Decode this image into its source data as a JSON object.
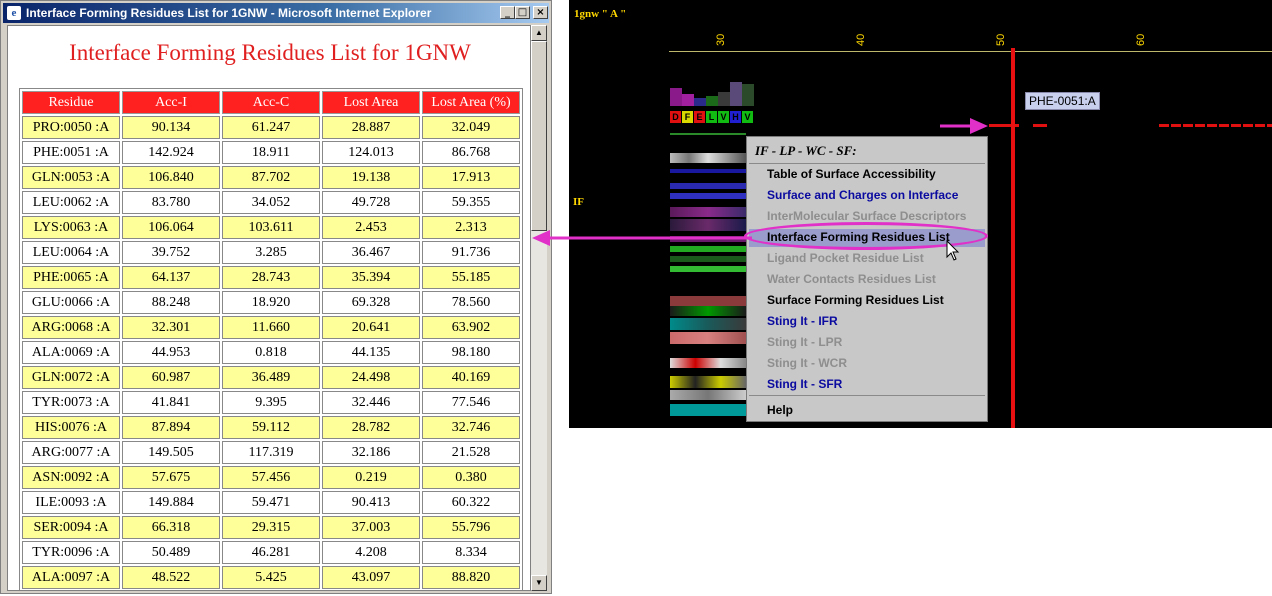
{
  "window": {
    "title": "Interface Forming Residues List for 1GNW - Microsoft Internet Explorer",
    "minimize_glyph": "_",
    "maximize_glyph": "□",
    "close_glyph": "×",
    "icon": "ie-icon"
  },
  "page": {
    "heading": "Interface Forming Residues List for 1GNW",
    "columns": [
      "Residue",
      "Acc-I",
      "Acc-C",
      "Lost Area",
      "Lost Area (%)"
    ],
    "rows": [
      [
        "PRO:0050 :A",
        "90.134",
        "61.247",
        "28.887",
        "32.049"
      ],
      [
        "PHE:0051 :A",
        "142.924",
        "18.911",
        "124.013",
        "86.768"
      ],
      [
        "GLN:0053 :A",
        "106.840",
        "87.702",
        "19.138",
        "17.913"
      ],
      [
        "LEU:0062 :A",
        "83.780",
        "34.052",
        "49.728",
        "59.355"
      ],
      [
        "LYS:0063 :A",
        "106.064",
        "103.611",
        "2.453",
        "2.313"
      ],
      [
        "LEU:0064 :A",
        "39.752",
        "3.285",
        "36.467",
        "91.736"
      ],
      [
        "PHE:0065 :A",
        "64.137",
        "28.743",
        "35.394",
        "55.185"
      ],
      [
        "GLU:0066 :A",
        "88.248",
        "18.920",
        "69.328",
        "78.560"
      ],
      [
        "ARG:0068 :A",
        "32.301",
        "11.660",
        "20.641",
        "63.902"
      ],
      [
        "ALA:0069 :A",
        "44.953",
        "0.818",
        "44.135",
        "98.180"
      ],
      [
        "GLN:0072 :A",
        "60.987",
        "36.489",
        "24.498",
        "40.169"
      ],
      [
        "TYR:0073 :A",
        "41.841",
        "9.395",
        "32.446",
        "77.546"
      ],
      [
        "HIS:0076 :A",
        "87.894",
        "59.112",
        "28.782",
        "32.746"
      ],
      [
        "ARG:0077 :A",
        "149.505",
        "117.319",
        "32.186",
        "21.528"
      ],
      [
        "ASN:0092 :A",
        "57.675",
        "57.456",
        "0.219",
        "0.380"
      ],
      [
        "ILE:0093 :A",
        "149.884",
        "59.471",
        "90.413",
        "60.322"
      ],
      [
        "SER:0094 :A",
        "66.318",
        "29.315",
        "37.003",
        "55.796"
      ],
      [
        "TYR:0096 :A",
        "50.489",
        "46.281",
        "4.208",
        "8.334"
      ],
      [
        "ALA:0097 :A",
        "48.522",
        "5.425",
        "43.097",
        "88.820"
      ]
    ]
  },
  "viewer": {
    "chain_label": "1gnw \" A \"",
    "if_label": "IF",
    "ticks": [
      "30",
      "40",
      "50",
      "60"
    ],
    "sequence_letters": [
      "D",
      "F",
      "E",
      "L",
      "V",
      "H",
      "V"
    ],
    "tooltip": "PHE-0051:A",
    "menu": {
      "header": "IF - LP - WC - SF:",
      "items": [
        {
          "label": "Table of Surface Accessibility",
          "state": "normal"
        },
        {
          "label": "Surface and Charges on Interface",
          "state": "link"
        },
        {
          "label": "InterMolecular Surface Descriptors",
          "state": "disabled"
        },
        {
          "label": "Interface Forming Residues List",
          "state": "selected"
        },
        {
          "label": "Ligand Pocket Residue List",
          "state": "disabled"
        },
        {
          "label": "Water Contacts Residues List",
          "state": "disabled"
        },
        {
          "label": "Surface Forming Residues List",
          "state": "normal"
        },
        {
          "label": "Sting It - IFR",
          "state": "link"
        },
        {
          "label": "Sting It - LPR",
          "state": "disabled"
        },
        {
          "label": "Sting It - WCR",
          "state": "disabled"
        },
        {
          "label": "Sting It - SFR",
          "state": "link"
        }
      ],
      "help": "Help"
    }
  },
  "colors": {
    "title_bar": "#0a246a",
    "header_red": "#ff2020",
    "row_yellow": "#ffff99",
    "annotation_magenta": "#e030c8",
    "menu_link": "#0a0aa0",
    "menu_disabled": "#8e8e8e"
  }
}
